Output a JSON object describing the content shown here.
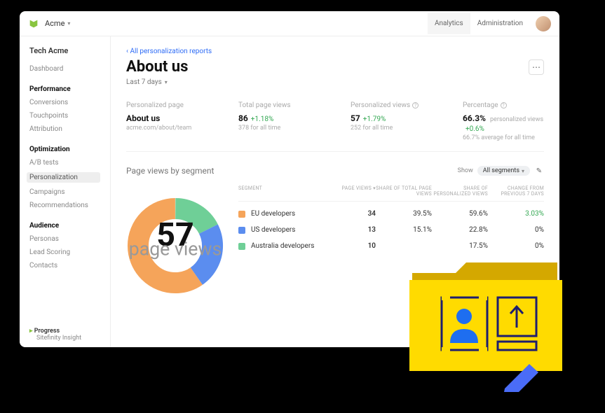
{
  "brand": "Acme",
  "top_nav": {
    "analytics": "Analytics",
    "administration": "Administration"
  },
  "sidebar": {
    "tenant": "Tech Acme",
    "dashboard": "Dashboard",
    "groups": {
      "performance": {
        "label": "Performance",
        "items": [
          "Conversions",
          "Touchpoints",
          "Attribution"
        ]
      },
      "optimization": {
        "label": "Optimization",
        "items": [
          "A/B tests",
          "Personalization",
          "Campaigns",
          "Recommendations"
        ]
      },
      "audience": {
        "label": "Audience",
        "items": [
          "Personas",
          "Lead Scoring",
          "Contacts"
        ]
      }
    },
    "footer_brand": "Progress",
    "footer_product": "Sitefinity Insight"
  },
  "crumb": "All personalization reports",
  "title": "About us",
  "range_label": "Last 7 days",
  "stats": {
    "page": {
      "label": "Personalized page",
      "head": "About us",
      "sub": "acme.com/about/team"
    },
    "total": {
      "label": "Total page views",
      "head": "86",
      "delta": "+1.18%",
      "sub": "378 for all time"
    },
    "personalized": {
      "label": "Personalized views",
      "head": "57",
      "delta": "+1.79%",
      "sub": "252 for all time"
    },
    "percentage": {
      "label": "Percentage",
      "head": "66.3%",
      "delta_note": "personalized views",
      "delta": "+0.6%",
      "sub": "66.7% average for all time"
    }
  },
  "segments_title": "Page views by segment",
  "segments_show": "Show",
  "segments_pill": "All segments",
  "table": {
    "headers": {
      "segment": "Segment",
      "views": "Page views",
      "share_total": "Share of total page views",
      "share_pers": "Share of personalized views",
      "change": "Change from previous 7 days"
    },
    "rows": [
      {
        "color": "#f5a45a",
        "name": "EU developers",
        "views": "34",
        "share_total": "39.5%",
        "share_pers": "59.6%",
        "change": "3.03%",
        "change_up": true
      },
      {
        "color": "#5b8def",
        "name": "US developers",
        "views": "13",
        "share_total": "15.1%",
        "share_pers": "22.8%",
        "change": "0%",
        "change_up": false
      },
      {
        "color": "#6fcf97",
        "name": "Australia developers",
        "views": "10",
        "share_total": "",
        "share_pers": "17.5%",
        "change": "0%",
        "change_up": false
      }
    ]
  },
  "donut": {
    "center_value": "57",
    "center_label": "page views"
  },
  "chart_data": {
    "type": "pie",
    "title": "Page views by segment",
    "series": [
      {
        "name": "EU developers",
        "value": 34,
        "color": "#f5a45a"
      },
      {
        "name": "US developers",
        "value": 13,
        "color": "#5b8def"
      },
      {
        "name": "Australia developers",
        "value": 10,
        "color": "#6fcf97"
      }
    ],
    "total": 57
  }
}
